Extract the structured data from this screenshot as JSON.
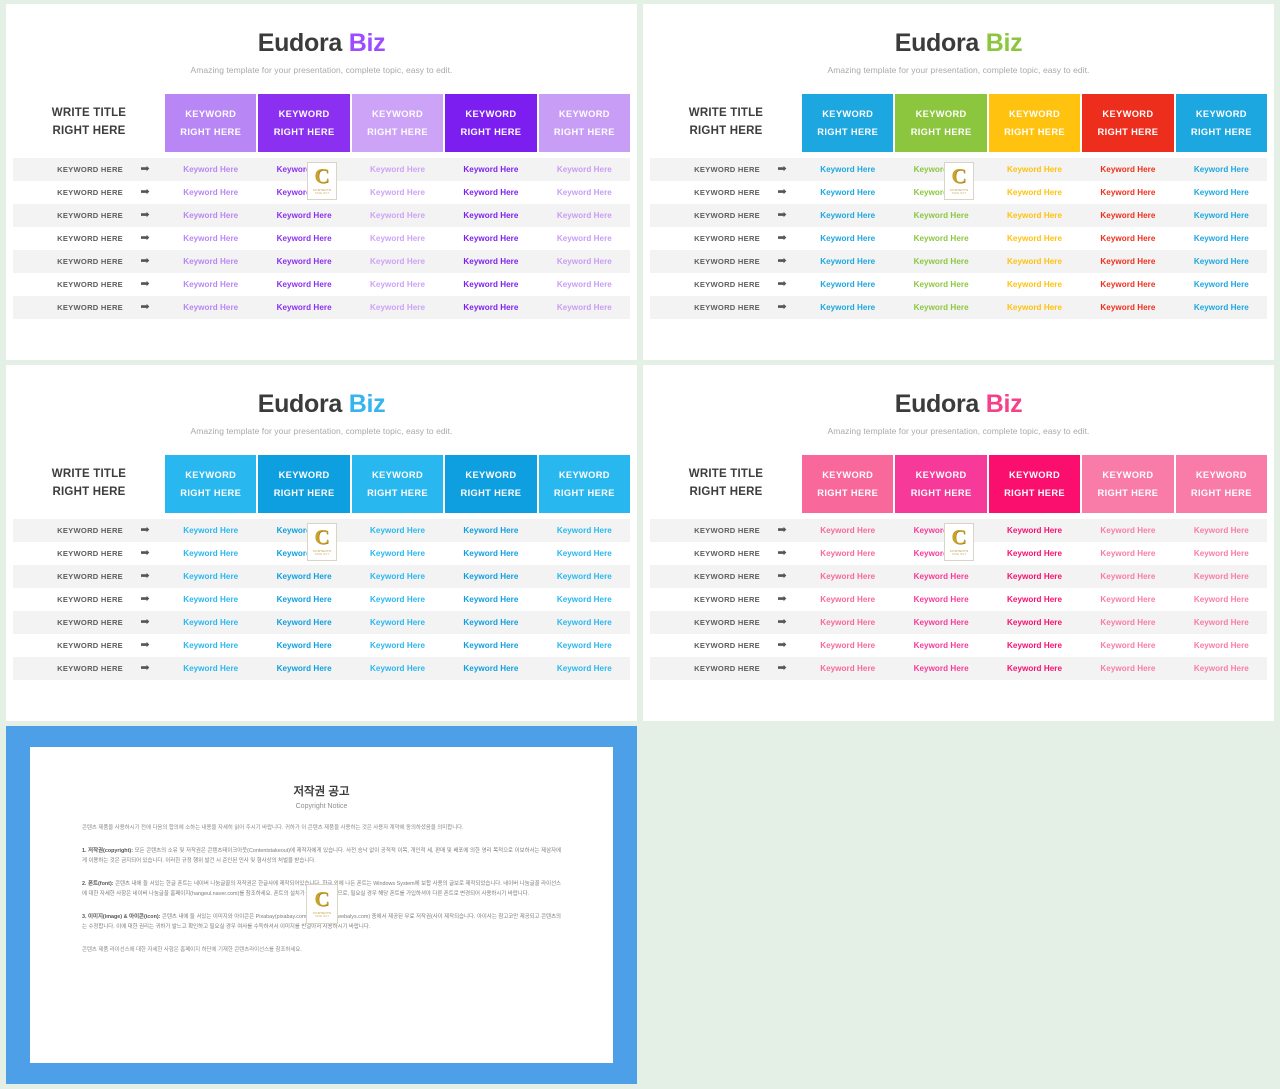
{
  "background_color": "#e4efe6",
  "common": {
    "title_main": "Eudora",
    "title_accent": "Biz",
    "subtitle": "Amazing template for your presentation, complete topic, easy to edit.",
    "left_header_line1": "WRITE TITLE",
    "left_header_line2": "RIGHT HERE",
    "header_cell_line1": "KEYWORD",
    "header_cell_line2": "RIGHT HERE",
    "row_label": "KEYWORD HERE",
    "cell_text": "Keyword Here",
    "arrow_icon": "➡",
    "row_count": 7,
    "column_count": 5
  },
  "watermark": {
    "letter": "C",
    "line1": "CONTENTS",
    "line2": "TAKE OUT"
  },
  "slides": [
    {
      "id": "slide-purple",
      "accent_color": "#9b4dff",
      "header_colors": [
        "#b887f5",
        "#8b2ff0",
        "#cda3f7",
        "#7c1ef0",
        "#c79df6"
      ],
      "cell_colors": [
        "#b887f5",
        "#8b2ff0",
        "#cda3f7",
        "#7c1ef0",
        "#c79df6"
      ]
    },
    {
      "id": "slide-multi",
      "accent_color": "#8cc63f",
      "header_colors": [
        "#1ca7e0",
        "#8cc63f",
        "#ffc20e",
        "#ee2e1c",
        "#1ca7e0"
      ],
      "cell_colors": [
        "#1ca7e0",
        "#8cc63f",
        "#ffc20e",
        "#ee2e1c",
        "#1ca7e0"
      ]
    },
    {
      "id": "slide-blue",
      "accent_color": "#35b4ee",
      "header_colors": [
        "#29b7f0",
        "#0e9fe0",
        "#29b7f0",
        "#0e9fe0",
        "#29b7f0"
      ],
      "cell_colors": [
        "#29b7f0",
        "#0e9fe0",
        "#29b7f0",
        "#0e9fe0",
        "#29b7f0"
      ]
    },
    {
      "id": "slide-pink",
      "accent_color": "#f5408a",
      "header_colors": [
        "#f9689b",
        "#f7399a",
        "#fa0e6e",
        "#f97ba7",
        "#f97ba7"
      ],
      "cell_colors": [
        "#f9689b",
        "#f7399a",
        "#fa0e6e",
        "#f97ba7",
        "#f97ba7"
      ]
    }
  ],
  "copyright": {
    "frame_color": "#4d9fe8",
    "heading_ko": "저작권 공고",
    "heading_en": "Copyright Notice",
    "intro": "콘텐츠 제품을 사용하시기 전에 다음의 합의에 소하는 내용을 자세히 읽어 주시기 바랍니다. 귀하가 이 콘텐츠 제품을 사용하는 것은 사용자 계약에 동의하셨음을 의미합니다.",
    "items": [
      {
        "label": "1. 저작권(copyright):",
        "text": "모든 콘텐츠의 소유 및 저작권은 콘텐츠테이크아웃(Contentstakeout)에 제작자에게 있습니다. 사전 승낙 없이 공적적 이목, 개인적 세, 판매 및 배포에 의한 영리 목적으로 이보하서는 제삼자에게 이용하는 것은 금지되어 있습니다. 이러한 규정 행위 발건 시 준인된 민사 및 형사상의 처벌을 받습니다."
      },
      {
        "label": "2. 폰트(font):",
        "text": "콘텐츠 내에 들 서있는 한글 폰트는 네이버 나눔글꼴의 저작권은 한글사에 제작되어있습니다. 한글 외에 나든 폰트는 Windows System에 보합 사용의 글보로 제작되었습니다. 네이버 나눔글꼴 라이선스에 대한 자세한 사항은 네이버 나눔글꼴 홈페이지(hangeul.naver.com)를 참조하세요. 폰트의 설치가 제외되어 있으므로, 필요실 경우 해당 폰트를 가입하셔야 다른 폰트로 변경되어 사용하시기 바랍니다."
      },
      {
        "label": "3. 이미지(image) & 아이콘(icon):",
        "text": "콘텐츠 내에 들 서있는 이미지와 아이콘은 Pixabay(pixabay.com)와 Webalys(webalys.com) 중에서 제공된 무료 저작권(사이 제작되습니다. 아이사는 참고코만 제공되고 콘텐츠의는 수정합니다. 이에 대한 권리는 귀하가 발느고 확인하고 필요실 경우 여사를 수득하셔서 이미지를 반걸아서 사용하시기 바랍니다."
      }
    ],
    "footer": "콘텐츠 제품 라이선스에 대한 자세한 사항은 홈페이지 하단에 기재한 콘텐츠라이선스를 참조하세요."
  }
}
